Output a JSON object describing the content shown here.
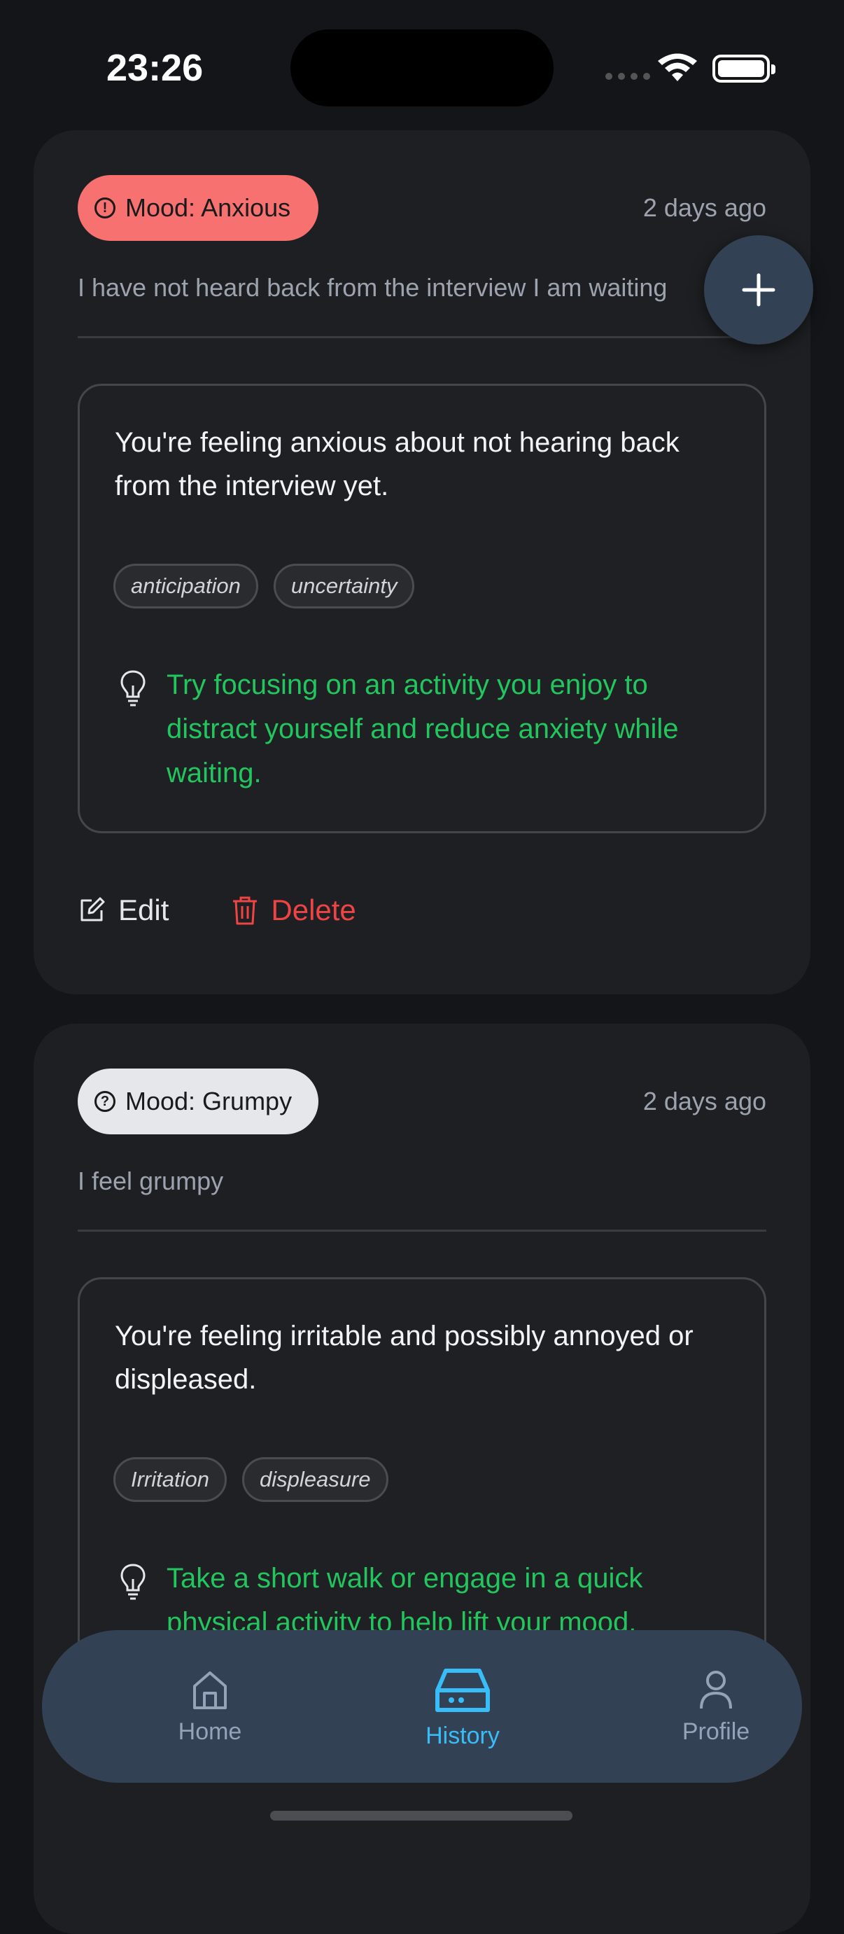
{
  "status_bar": {
    "time": "23:26"
  },
  "entries": [
    {
      "mood_label": "Mood: Anxious",
      "mood_icon": "alert-circle-icon",
      "mood_color": "#f87171",
      "time_ago": "2 days ago",
      "text": "I have not heard back from the interview I am waiting",
      "summary": "You're feeling anxious about not hearing back from the interview yet.",
      "tags": [
        "anticipation",
        "uncertainty"
      ],
      "tip": "Try focusing on an activity you enjoy to distract yourself and reduce anxiety while waiting.",
      "edit_label": "Edit",
      "delete_label": "Delete"
    },
    {
      "mood_label": "Mood: Grumpy",
      "mood_icon": "help-circle-icon",
      "mood_color": "#e5e7eb",
      "time_ago": "2 days ago",
      "text": "I feel grumpy",
      "summary": "You're feeling irritable and possibly annoyed or displeased.",
      "tags": [
        "Irritation",
        "displeasure"
      ],
      "tip": "Take a short walk or engage in a quick physical activity to help lift your mood."
    }
  ],
  "nav": {
    "home_label": "Home",
    "history_label": "History",
    "profile_label": "Profile",
    "active": "History",
    "active_color": "#38bdf8"
  },
  "colors": {
    "tip": "#22c55e",
    "delete": "#ef4444",
    "background": "#141518",
    "card": "#1e1f22"
  }
}
